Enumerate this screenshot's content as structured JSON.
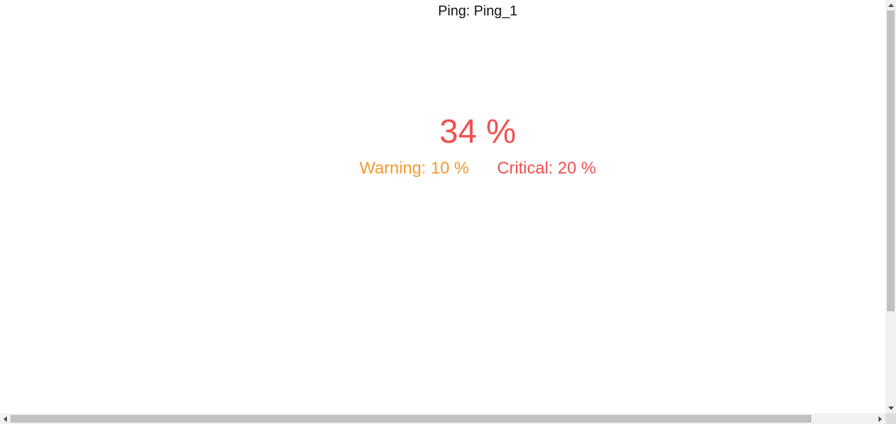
{
  "widget": {
    "title": "Ping: Ping_1",
    "value_text": "34 %",
    "warning_text": "Warning: 10 %",
    "critical_text": "Critical: 20 %"
  },
  "colors": {
    "value": "#f24f4f",
    "warning": "#f59a2e",
    "critical": "#f24f4f",
    "title": "#111111"
  },
  "icons": {
    "scroll_up": "chevron-up-icon",
    "scroll_down": "chevron-down-icon",
    "scroll_left": "chevron-left-icon",
    "scroll_right": "chevron-right-icon"
  }
}
